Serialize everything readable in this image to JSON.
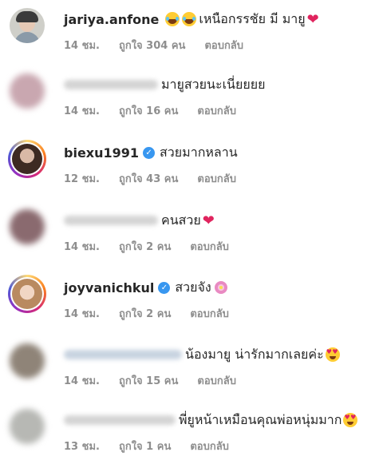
{
  "comments": [
    {
      "username": "jariya.anfone",
      "verified": false,
      "text": "เหนือกรรชัย มี มายู",
      "time": "14 ชม.",
      "likes": "ถูกใจ 304 คน",
      "reply": "ตอบกลับ"
    },
    {
      "username": "",
      "verified": false,
      "text": "มายูสวยนะเนี่ยยยย",
      "time": "14 ชม.",
      "likes": "ถูกใจ 16 คน",
      "reply": "ตอบกลับ"
    },
    {
      "username": "biexu1991",
      "verified": true,
      "text": "สวยมากหลาน",
      "time": "12 ชม.",
      "likes": "ถูกใจ 43 คน",
      "reply": "ตอบกลับ"
    },
    {
      "username": "",
      "verified": false,
      "text": "คนสวย",
      "time": "14 ชม.",
      "likes": "ถูกใจ 2 คน",
      "reply": "ตอบกลับ"
    },
    {
      "username": "joyvanichkul",
      "verified": true,
      "text": "สวยจัง",
      "time": "14 ชม.",
      "likes": "ถูกใจ 2 คน",
      "reply": "ตอบกลับ"
    },
    {
      "username": "",
      "verified": false,
      "text": "น้องมายู น่ารักมากเลยค่ะ",
      "time": "14 ชม.",
      "likes": "ถูกใจ 15 คน",
      "reply": "ตอบกลับ"
    },
    {
      "username": "",
      "verified": false,
      "text": "พี่ยูหน้าเหมือนคุณพ่อหนุ่มมาก",
      "time": "13 ชม.",
      "likes": "ถูกใจ 1 คน",
      "reply": "ตอบกลับ"
    }
  ],
  "icons": {
    "verified": "verified-badge-icon",
    "heart_color": "#e0245e",
    "accent": "#3897f0"
  }
}
